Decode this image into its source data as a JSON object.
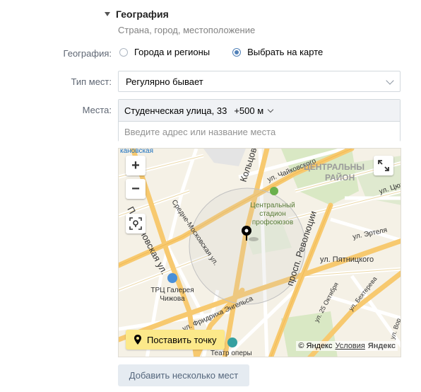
{
  "section": {
    "title": "География",
    "subtitle": "Страна, город, местоположение"
  },
  "geo": {
    "label": "География:",
    "options": [
      {
        "label": "Города и регионы",
        "selected": false
      },
      {
        "label": "Выбрать на карте",
        "selected": true
      }
    ]
  },
  "place_type": {
    "label": "Тип мест:",
    "value": "Регулярно бывает"
  },
  "places": {
    "label": "Места:",
    "item": "Студенческая улица, 33",
    "radius": "+500 м",
    "input_placeholder": "Введите адрес или название места"
  },
  "map": {
    "zoom_in": "+",
    "zoom_out": "−",
    "place_point_label": "Поставить точку",
    "copyright": "© Яндекс",
    "terms": "Условия",
    "brand": "Яндекс",
    "labels": {
      "top_cut": "кановская",
      "kolcovskaya": "Кольцовска",
      "chaikovskogo": "ул. Чайковского",
      "central1": "ЦЕНТРАЛЬНЫ",
      "central2": "РАЙОН",
      "tsyur": "ул. Цюр",
      "stadium1": "Центральный",
      "stadium2": "стадион",
      "stadium3": "профсоюзов",
      "srednemoskovskaya": "Средне-Московская ул.",
      "plekhanovskaya": "Плехановская ул.",
      "revolyutsii": "просп. Революции",
      "ertelya": "ул. Эртеля",
      "pyatnitskogo": "ул. Пятницкого",
      "mall1": "ТРЦ Галерея",
      "mall2": "Чижова",
      "engelsa": "ул. Фридриха Энгельса",
      "oktyabrya": "ул. 25 Октября",
      "bekhtereva": "ул. Бехтерева",
      "teatr": "Театр оперы",
      "vorovskogo": "ул. Вор"
    }
  },
  "add_button": "Добавить несколько мест"
}
